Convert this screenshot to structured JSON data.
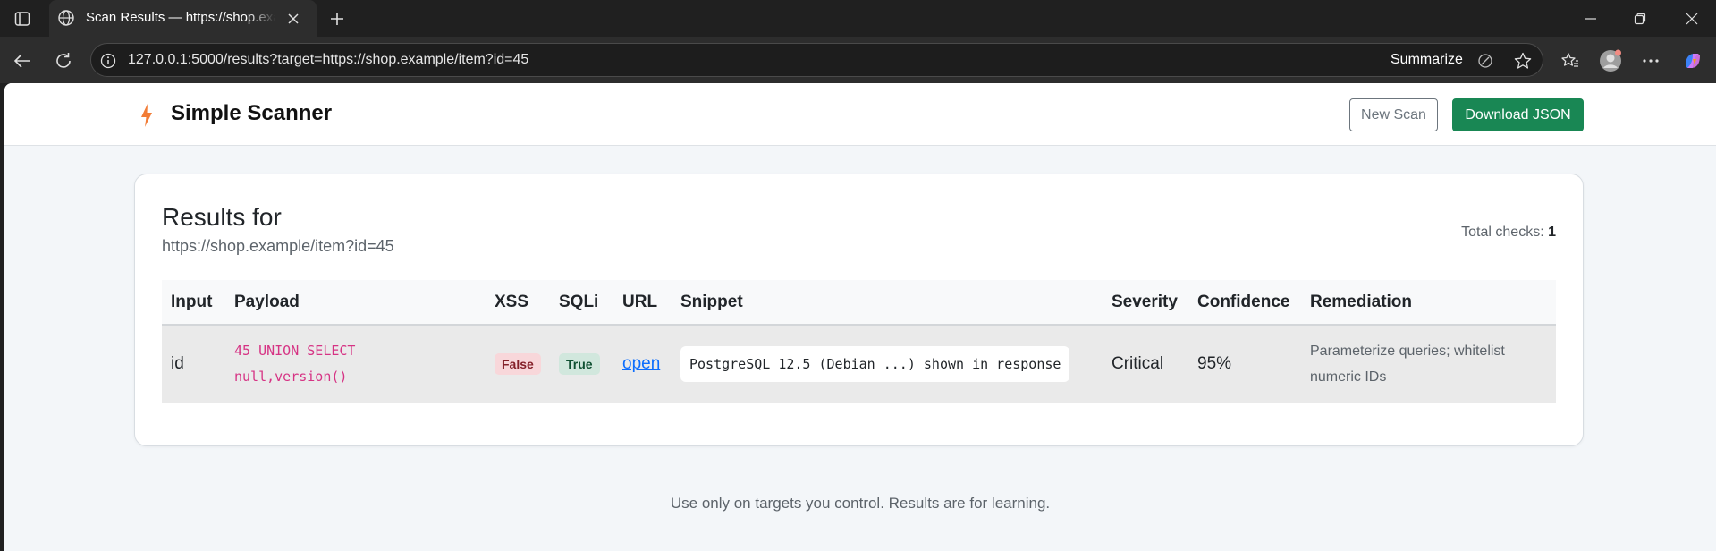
{
  "browser": {
    "tab_title": "Scan Results — https://shop.example/item?id=45",
    "url": "127.0.0.1:5000/results?target=https://shop.example/item?id=45",
    "summarize_label": "Summarize"
  },
  "header": {
    "brand": "Simple Scanner",
    "new_scan_label": "New Scan",
    "download_label": "Download JSON",
    "accent_color": "#198754"
  },
  "results": {
    "title": "Results for",
    "target": "https://shop.example/item?id=45",
    "total_checks_label": "Total checks:",
    "total_checks_value": "1",
    "columns": [
      "Input",
      "Payload",
      "XSS",
      "SQLi",
      "URL",
      "Snippet",
      "Severity",
      "Confidence",
      "Remediation"
    ],
    "rows": [
      {
        "input": "id",
        "payload_line1": "45 UNION SELECT",
        "payload_line2": "null,version()",
        "xss": "False",
        "sqli": "True",
        "url_label": "open",
        "snippet": "PostgreSQL 12.5 (Debian ...) shown in response",
        "severity": "Critical",
        "confidence": "95%",
        "remediation_line1": "Parameterize queries; whitelist",
        "remediation_line2": "numeric IDs"
      }
    ]
  },
  "footer": {
    "note": "Use only on targets you control. Results are for learning."
  }
}
